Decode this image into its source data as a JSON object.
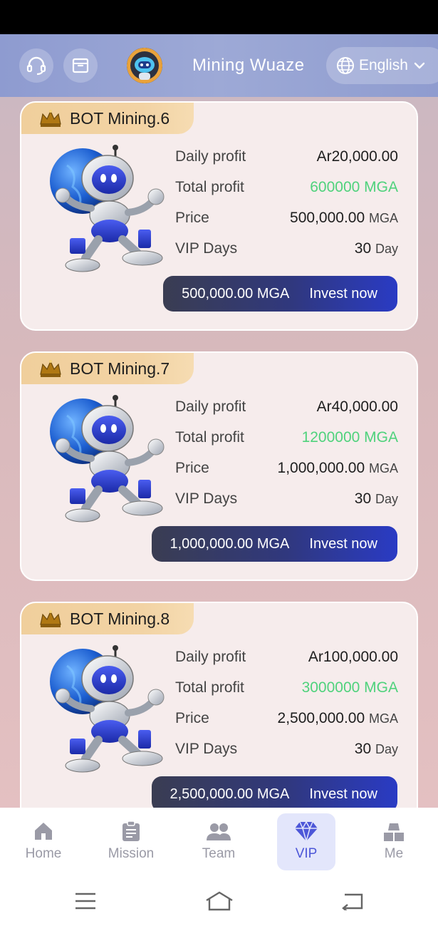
{
  "header": {
    "title": "Mining Wuaze",
    "language": "English",
    "icons": [
      "headset-icon",
      "inbox-icon",
      "robot-avatar",
      "globe-icon",
      "chevron-down-icon"
    ]
  },
  "plans": [
    {
      "name": "BOT Mining.6",
      "daily_label": "Daily profit",
      "daily_value": "Ar20,000.00",
      "total_label": "Total profit",
      "total_value": "600000 MGA",
      "price_label": "Price",
      "price_value": "500,000.00",
      "price_unit": "MGA",
      "days_label": "VIP Days",
      "days_value": "30",
      "days_unit": "Day",
      "button_amount": "500,000.00 MGA",
      "button_label": "Invest now"
    },
    {
      "name": "BOT Mining.7",
      "daily_label": "Daily profit",
      "daily_value": "Ar40,000.00",
      "total_label": "Total profit",
      "total_value": "1200000 MGA",
      "price_label": "Price",
      "price_value": "1,000,000.00",
      "price_unit": "MGA",
      "days_label": "VIP Days",
      "days_value": "30",
      "days_unit": "Day",
      "button_amount": "1,000,000.00 MGA",
      "button_label": "Invest now"
    },
    {
      "name": "BOT Mining.8",
      "daily_label": "Daily profit",
      "daily_value": "Ar100,000.00",
      "total_label": "Total profit",
      "total_value": "3000000 MGA",
      "price_label": "Price",
      "price_value": "2,500,000.00",
      "price_unit": "MGA",
      "days_label": "VIP Days",
      "days_value": "30",
      "days_unit": "Day",
      "button_amount": "2,500,000.00 MGA",
      "button_label": "Invest now"
    }
  ],
  "tabs": [
    {
      "label": "Home",
      "icon": "home-icon"
    },
    {
      "label": "Mission",
      "icon": "clipboard-icon"
    },
    {
      "label": "Team",
      "icon": "team-icon"
    },
    {
      "label": "VIP",
      "icon": "diamond-icon",
      "active": true
    },
    {
      "label": "Me",
      "icon": "boxes-icon"
    }
  ],
  "colors": {
    "accent": "#4d57d8",
    "green": "#4fd27c",
    "tag_gold": "#f0cf9c",
    "header": "#8e9bd0"
  }
}
